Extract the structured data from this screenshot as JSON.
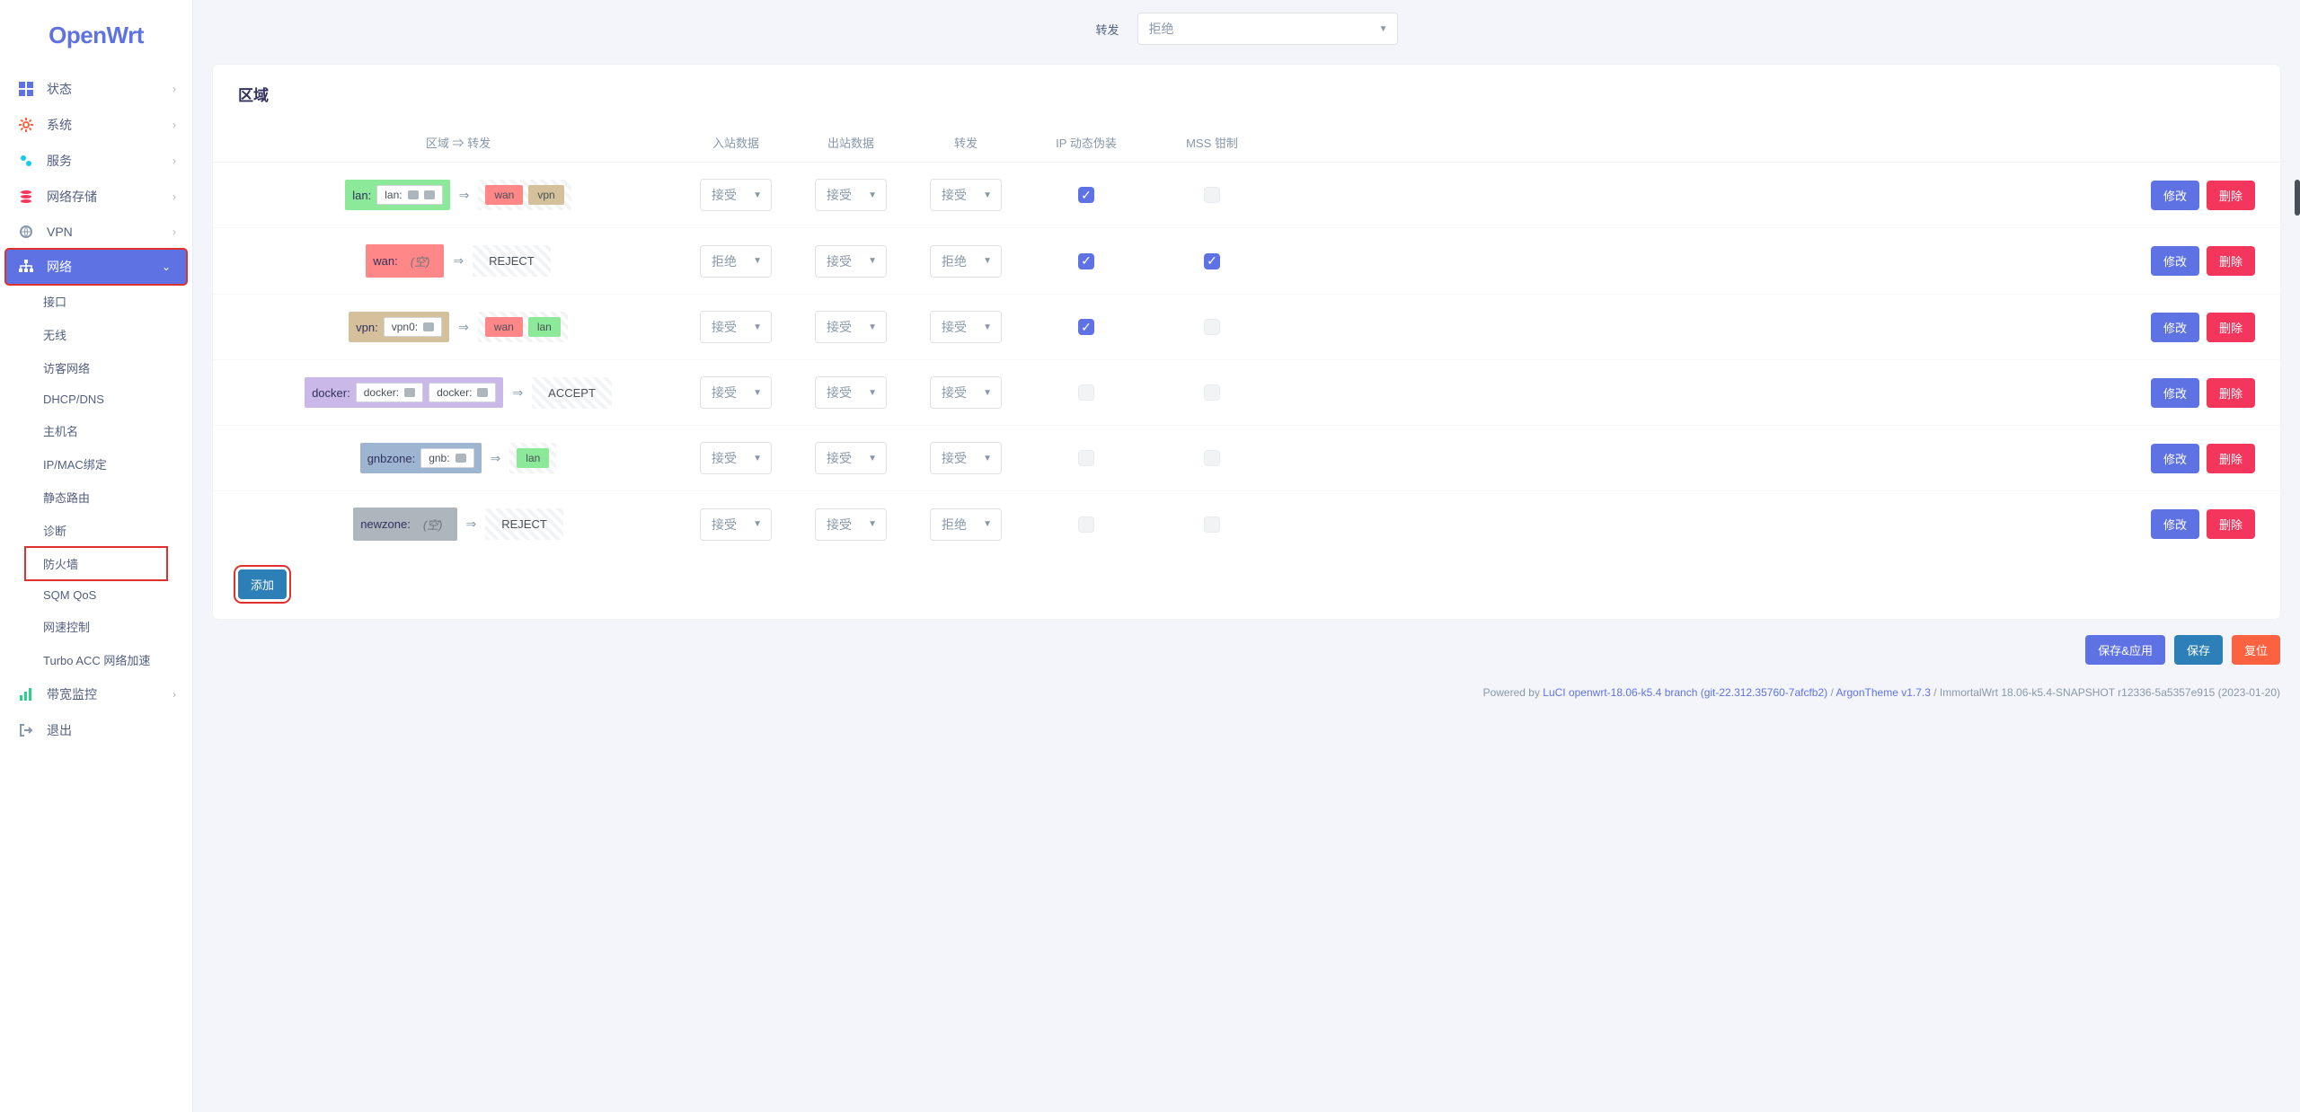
{
  "logo": "OpenWrt",
  "nav": {
    "status": "状态",
    "system": "系统",
    "services": "服务",
    "nas": "网络存储",
    "vpn": "VPN",
    "network": "网络",
    "bandwidth": "带宽监控",
    "logout": "退出"
  },
  "subnav": {
    "interfaces": "接口",
    "wireless": "无线",
    "guest": "访客网络",
    "dhcpdns": "DHCP/DNS",
    "hostnames": "主机名",
    "ipmac": "IP/MAC绑定",
    "routes": "静态路由",
    "diag": "诊断",
    "firewall": "防火墙",
    "sqm": "SQM QoS",
    "speed": "网速控制",
    "turbo": "Turbo ACC 网络加速"
  },
  "topForward": {
    "label": "转发",
    "value": "拒绝"
  },
  "card": {
    "title": "区域",
    "headers": {
      "zone": "区域 ⇒ 转发",
      "input": "入站数据",
      "output": "出站数据",
      "forward": "转发",
      "masq": "IP 动态伪装",
      "mss": "MSS 钳制"
    }
  },
  "rows": [
    {
      "srcLabel": "lan:",
      "srcBg": "bg-green",
      "inner": [
        "lan:"
      ],
      "innerIcons": 2,
      "dests": [
        {
          "text": "wan",
          "bg": "bg-red"
        },
        {
          "text": "vpn",
          "bg": "bg-tan"
        }
      ],
      "destText": null,
      "in": "接受",
      "out": "接受",
      "fwd": "接受",
      "masq": true,
      "mss": false
    },
    {
      "srcLabel": "wan:",
      "srcBg": "bg-red",
      "inner": [],
      "emptyText": "(空)",
      "dests": [],
      "destText": "REJECT",
      "in": "拒绝",
      "out": "接受",
      "fwd": "拒绝",
      "masq": true,
      "mss": true
    },
    {
      "srcLabel": "vpn:",
      "srcBg": "bg-tan",
      "inner": [
        "vpn0:"
      ],
      "innerIcons": 1,
      "dests": [
        {
          "text": "wan",
          "bg": "bg-red"
        },
        {
          "text": "lan",
          "bg": "bg-green"
        }
      ],
      "destText": null,
      "in": "接受",
      "out": "接受",
      "fwd": "接受",
      "masq": true,
      "mss": false
    },
    {
      "srcLabel": "docker:",
      "srcBg": "bg-purple",
      "inner": [
        "docker:",
        "docker:"
      ],
      "innerIcons": 1,
      "dests": [],
      "destText": "ACCEPT",
      "in": "接受",
      "out": "接受",
      "fwd": "接受",
      "masq": false,
      "mss": false
    },
    {
      "srcLabel": "gnbzone:",
      "srcBg": "bg-bluegray",
      "inner": [
        "gnb:"
      ],
      "innerIcons": 1,
      "dests": [
        {
          "text": "lan",
          "bg": "bg-green"
        }
      ],
      "destText": null,
      "in": "接受",
      "out": "接受",
      "fwd": "接受",
      "masq": false,
      "mss": false
    },
    {
      "srcLabel": "newzone:",
      "srcBg": "bg-gray",
      "inner": [],
      "emptyText": "(空)",
      "dests": [],
      "destText": "REJECT",
      "in": "接受",
      "out": "接受",
      "fwd": "拒绝",
      "masq": false,
      "mss": false
    }
  ],
  "buttons": {
    "edit": "修改",
    "delete": "删除",
    "add": "添加",
    "saveApply": "保存&应用",
    "save": "保存",
    "reset": "复位"
  },
  "footer": {
    "prefix": "Powered by ",
    "link1": "LuCI openwrt-18.06-k5.4 branch (git-22.312.35760-7afcfb2)",
    "sep": " / ",
    "link2": "ArgonTheme v1.7.3",
    "tail": " / ImmortalWrt 18.06-k5.4-SNAPSHOT r12336-5a5357e915 (2023-01-20)"
  }
}
